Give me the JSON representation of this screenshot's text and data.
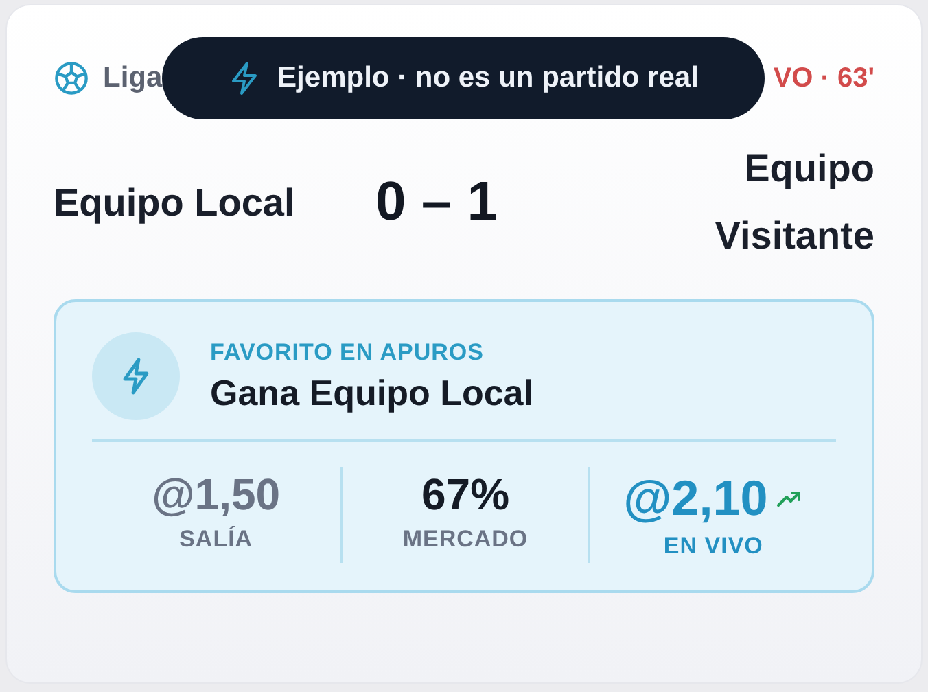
{
  "toast": {
    "text": "Ejemplo · no es un partido real"
  },
  "header": {
    "league": "Liga",
    "status": "VO · 63'"
  },
  "match": {
    "home": "Equipo Local",
    "score": "0 – 1",
    "away": "Equipo Visitante"
  },
  "alert": {
    "eyebrow": "FAVORITO EN APUROS",
    "title": "Gana Equipo Local",
    "stats": [
      {
        "kind": "old",
        "value": "@1,50",
        "label": "SALÍA"
      },
      {
        "kind": "market",
        "value": "67%",
        "label": "MERCADO"
      },
      {
        "kind": "live",
        "value": "@2,10",
        "label": "EN VIVO",
        "rising": true
      }
    ]
  }
}
